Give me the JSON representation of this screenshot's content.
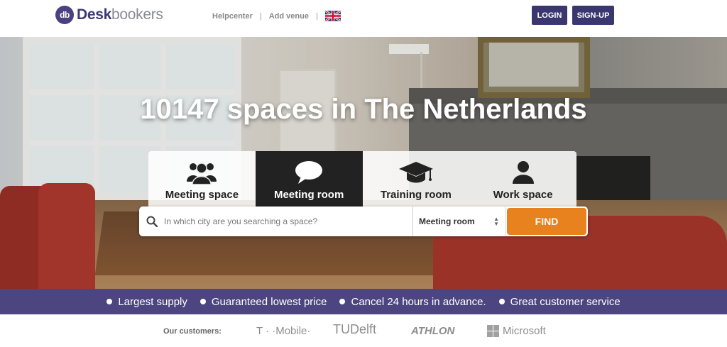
{
  "header": {
    "logo_badge": "db",
    "logo_desk": "Desk",
    "logo_bookers": "bookers",
    "nav": [
      "Helpcenter",
      "Add venue"
    ],
    "nav_sep": "|",
    "language_icon": "uk-flag-icon",
    "login_label": "LOGIN",
    "signup_label": "SIGN-UP"
  },
  "hero": {
    "headline": "10147 spaces in The Netherlands"
  },
  "tabs": [
    {
      "label": "Meeting space",
      "icon": "group-icon",
      "active": false
    },
    {
      "label": "Meeting room",
      "icon": "speech-bubble-icon",
      "active": true
    },
    {
      "label": "Training room",
      "icon": "graduation-cap-icon",
      "active": false
    },
    {
      "label": "Work space",
      "icon": "person-icon",
      "active": false
    }
  ],
  "search": {
    "placeholder": "In which city are you searching a space?",
    "type_value": "Meeting room",
    "find_label": "FIND"
  },
  "usps": [
    "Largest supply",
    "Guaranteed lowest price",
    "Cancel 24 hours in advance.",
    "Great customer service"
  ],
  "customers": {
    "label": "Our customers:",
    "logos": [
      "T · ·Mobile·",
      "TUDelft",
      "ATHLON",
      "Microsoft"
    ]
  },
  "colors": {
    "brand_purple": "#3a3670",
    "usp_bar": "#4c4580",
    "find_orange": "#e8821e",
    "active_tab": "#222222"
  }
}
